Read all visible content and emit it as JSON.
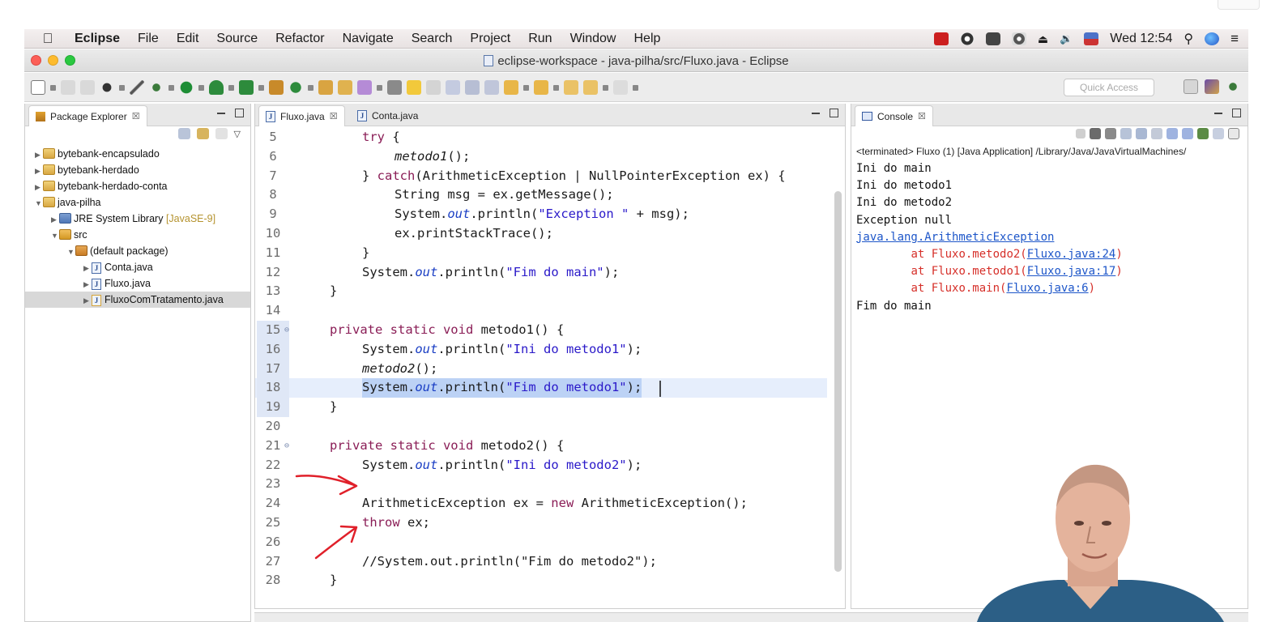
{
  "menubar": {
    "app": "Eclipse",
    "items": [
      "File",
      "Edit",
      "Source",
      "Refactor",
      "Navigate",
      "Search",
      "Project",
      "Run",
      "Window",
      "Help"
    ],
    "clock": "Wed 12:54"
  },
  "window": {
    "title": "eclipse-workspace - java-pilha/src/Fluxo.java - Eclipse"
  },
  "toolbar": {
    "quick_access_placeholder": "Quick Access"
  },
  "package_explorer": {
    "tab_label": "Package Explorer",
    "close_glyph": "☒",
    "tree": [
      {
        "label": "bytebank-encapsulado",
        "depth": 0,
        "expanded": false,
        "type": "project"
      },
      {
        "label": "bytebank-herdado",
        "depth": 0,
        "expanded": false,
        "type": "project"
      },
      {
        "label": "bytebank-herdado-conta",
        "depth": 0,
        "expanded": false,
        "type": "project"
      },
      {
        "label": "java-pilha",
        "depth": 0,
        "expanded": true,
        "type": "project"
      },
      {
        "label": "JRE System Library",
        "decor": "[JavaSE-9]",
        "depth": 1,
        "expanded": false,
        "type": "library"
      },
      {
        "label": "src",
        "depth": 1,
        "expanded": true,
        "type": "source"
      },
      {
        "label": "(default package)",
        "depth": 2,
        "expanded": true,
        "type": "package"
      },
      {
        "label": "Conta.java",
        "depth": 3,
        "expanded": false,
        "type": "java"
      },
      {
        "label": "Fluxo.java",
        "depth": 3,
        "expanded": false,
        "type": "java"
      },
      {
        "label": "FluxoComTratamento.java",
        "depth": 3,
        "expanded": false,
        "type": "java",
        "selected": true
      }
    ]
  },
  "editor": {
    "tabs": [
      {
        "label": "Fluxo.java",
        "active": true,
        "close_glyph": "☒"
      },
      {
        "label": "Conta.java",
        "active": false
      }
    ],
    "lines": [
      {
        "n": "5"
      },
      {
        "n": "6"
      },
      {
        "n": "7"
      },
      {
        "n": "8"
      },
      {
        "n": "9"
      },
      {
        "n": "10"
      },
      {
        "n": "11"
      },
      {
        "n": "12"
      },
      {
        "n": "13"
      },
      {
        "n": "14"
      },
      {
        "n": "15"
      },
      {
        "n": "16"
      },
      {
        "n": "17"
      },
      {
        "n": "18"
      },
      {
        "n": "19"
      },
      {
        "n": "20"
      },
      {
        "n": "21"
      },
      {
        "n": "22"
      },
      {
        "n": "23"
      },
      {
        "n": "24"
      },
      {
        "n": "25"
      },
      {
        "n": "26"
      },
      {
        "n": "27"
      },
      {
        "n": "28"
      }
    ],
    "code": {
      "l5_kw": "try",
      "l5_rest": " {",
      "l6": "metodo1",
      "l6_rest": "();",
      "l7_a": "} ",
      "l7_kw": "catch",
      "l7_b": "(ArithmeticException | NullPointerException ex) {",
      "l8": "String msg = ex.getMessage();",
      "l9_a": "System.",
      "l9_f": "out",
      "l9_b": ".println(",
      "l9_s": "\"Exception \"",
      "l9_c": " + msg);",
      "l10": "ex.printStackTrace();",
      "l11": "}",
      "l12_a": "System.",
      "l12_f": "out",
      "l12_b": ".println(",
      "l12_s": "\"Fim do main\"",
      "l12_c": ");",
      "l13": "}",
      "l15_kw": "private static void",
      "l15_rest": " metodo1() {",
      "l16_a": "System.",
      "l16_f": "out",
      "l16_b": ".println(",
      "l16_s": "\"Ini do metodo1\"",
      "l16_c": ");",
      "l17": "metodo2",
      "l17_rest": "();",
      "l18_a": "System.",
      "l18_f": "out",
      "l18_b": ".println(",
      "l18_s": "\"Fim do metodo1\"",
      "l18_c": ");",
      "l19": "}",
      "l21_kw": "private static void",
      "l21_rest": " metodo2() {",
      "l22_a": "System.",
      "l22_f": "out",
      "l22_b": ".println(",
      "l22_s": "\"Ini do metodo2\"",
      "l22_c": ");",
      "l24_a": "ArithmeticException ex = ",
      "l24_kw": "new",
      "l24_b": " ArithmeticException();",
      "l25_kw": "throw",
      "l25_rest": " ex;",
      "l27": "//System.out.println(\"Fim do metodo2\");",
      "l28": "}"
    }
  },
  "console": {
    "tab_label": "Console",
    "close_glyph": "☒",
    "status": "<terminated> Fluxo (1) [Java Application] /Library/Java/JavaVirtualMachines/",
    "out1": "Ini do main",
    "out2": "Ini do metodo1",
    "out3": "Ini do metodo2",
    "out4": "Exception null",
    "exc": "java.lang.ArithmeticException",
    "st1_a": "\tat Fluxo.metodo2(",
    "st1_l": "Fluxo.java:24",
    "st1_b": ")",
    "st2_a": "\tat Fluxo.metodo1(",
    "st2_l": "Fluxo.java:17",
    "st2_b": ")",
    "st3_a": "\tat Fluxo.main(",
    "st3_l": "Fluxo.java:6",
    "st3_b": ")",
    "out5": "Fim do main"
  },
  "colors": {
    "keyword": "#8a1d56",
    "string": "#2a19c9",
    "field": "#1a3ec4",
    "error": "#d6302a",
    "link": "#1d56c9",
    "annotation_red": "#e0202a"
  }
}
